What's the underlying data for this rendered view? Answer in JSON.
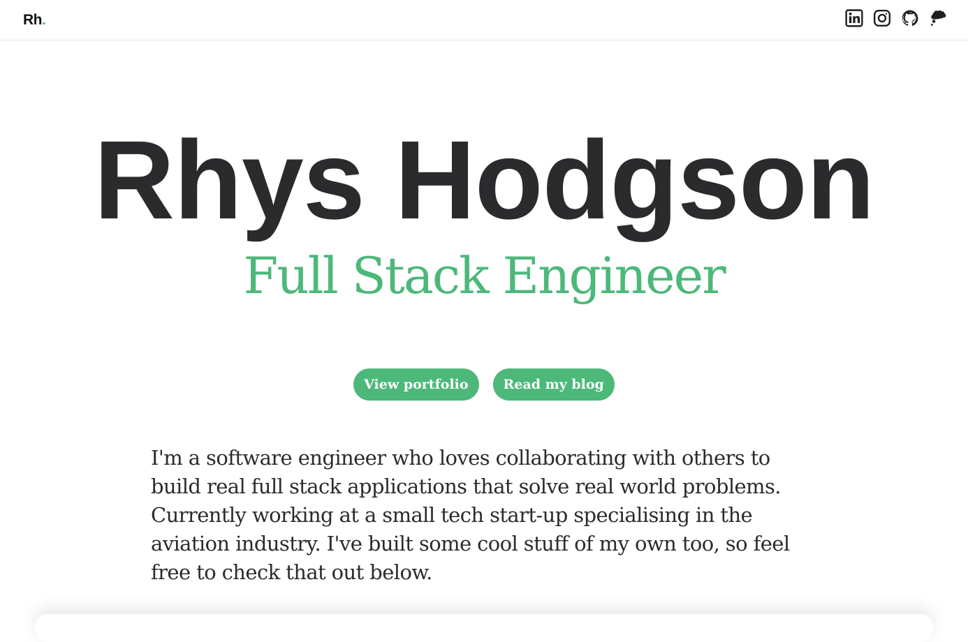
{
  "header": {
    "logo_text": "Rh",
    "logo_dot": ".",
    "accent_color": "#4cb87a",
    "social_links": [
      {
        "name": "linkedin-icon",
        "label": "LinkedIn"
      },
      {
        "name": "instagram-icon",
        "label": "Instagram"
      },
      {
        "name": "github-icon",
        "label": "GitHub"
      },
      {
        "name": "blog-icon",
        "label": "Blog"
      }
    ]
  },
  "hero": {
    "name": "Rhys Hodgson",
    "role": "Full Stack Engineer",
    "buttons": {
      "portfolio_label": "View portfolio",
      "blog_label": "Read my blog"
    },
    "intro": "I'm a software engineer who loves collaborating with others to build real full stack applications that solve real world problems. Currently working at a small tech start-up specialising in the aviation industry. I've built some cool stuff of my own too, so feel free to check that out below."
  }
}
